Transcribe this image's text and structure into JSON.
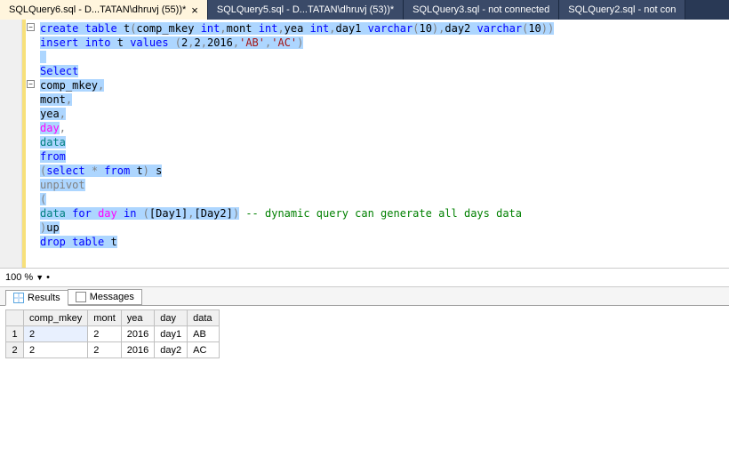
{
  "tabs": [
    {
      "label": "SQLQuery6.sql - D...TATAN\\dhruvj (55))*",
      "active": true,
      "closable": true
    },
    {
      "label": "SQLQuery5.sql - D...TATAN\\dhruvj (53))*",
      "active": false,
      "closable": false
    },
    {
      "label": "SQLQuery3.sql - not connected",
      "active": false,
      "closable": false
    },
    {
      "label": "SQLQuery2.sql - not con",
      "active": false,
      "closable": false
    }
  ],
  "code": {
    "l1a": "create",
    "l1b": "table",
    "l1c": "t",
    "l1d": "comp_mkey",
    "l1e": "int",
    "l1f": "mont",
    "l1g": "int",
    "l1h": "yea",
    "l1i": "int",
    "l1j": "day1",
    "l1k": "varchar",
    "l1l": "10",
    "l1m": "day2",
    "l1n": "varchar",
    "l1o": "10",
    "l2a": "insert",
    "l2b": "into",
    "l2c": "t",
    "l2d": "values",
    "l2e": "2",
    "l2f": "2",
    "l2g": "2016",
    "l2h": "'AB'",
    "l2i": "'AC'",
    "l4a": "Select",
    "l5a": "comp_mkey",
    "l6a": "mont",
    "l7a": "yea",
    "l8a": "day",
    "l9a": "data",
    "l10a": "from",
    "l11a": "select",
    "l11b": "*",
    "l11c": "from",
    "l11d": "t",
    "l11e": "s",
    "l12a": "unpivot",
    "l13a": "(",
    "l14a": "data",
    "l14b": "for",
    "l14c": "day",
    "l14d": "in",
    "l14e": "[Day1]",
    "l14f": "[Day2]",
    "l14g": "-- dynamic query can generate all days data",
    "l15a": "up",
    "l16a": "drop",
    "l16b": "table",
    "l16c": "t"
  },
  "zoom": {
    "value": "100 %"
  },
  "result_tabs": {
    "results": "Results",
    "messages": "Messages"
  },
  "grid": {
    "headers": [
      "comp_mkey",
      "mont",
      "yea",
      "day",
      "data"
    ],
    "corner": "",
    "rows": [
      {
        "n": "1",
        "cells": [
          "2",
          "2",
          "2016",
          "day1",
          "AB"
        ]
      },
      {
        "n": "2",
        "cells": [
          "2",
          "2",
          "2016",
          "day2",
          "AC"
        ]
      }
    ]
  },
  "fold": {
    "sym": "−"
  }
}
